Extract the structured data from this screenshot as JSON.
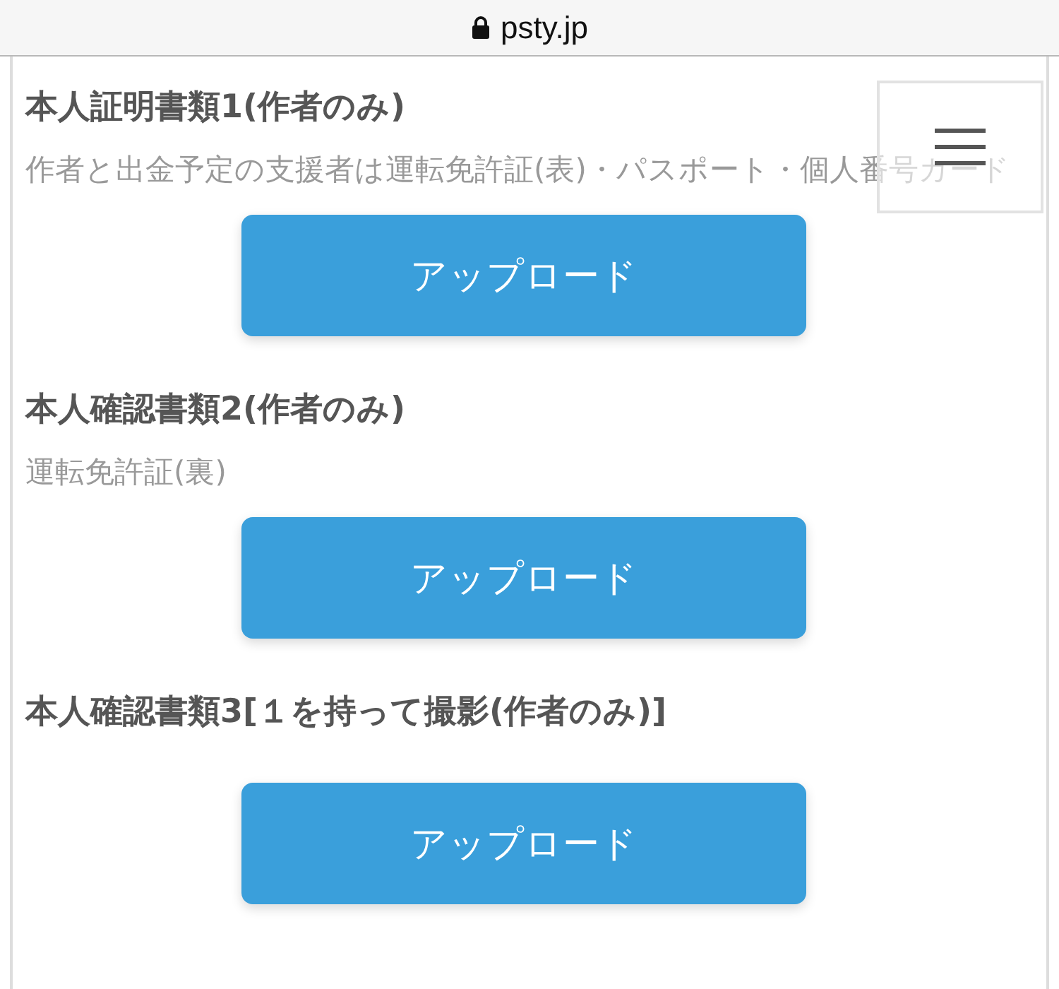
{
  "address_bar": {
    "url": "psty.jp"
  },
  "sections": [
    {
      "title": "本人証明書類1(作者のみ)",
      "description": "作者と出金予定の支援者は運転免許証(表)・パスポート・個人番号カード",
      "button": "アップロード"
    },
    {
      "title": "本人確認書類2(作者のみ)",
      "description": "運転免許証(裏)",
      "button": "アップロード"
    },
    {
      "title": "本人確認書類3[１を持って撮影(作者のみ)]",
      "button": "アップロード"
    }
  ]
}
